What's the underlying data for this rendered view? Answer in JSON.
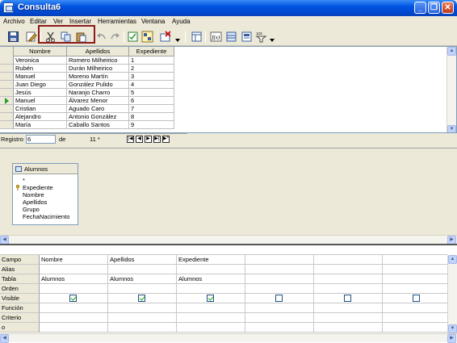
{
  "window": {
    "title": "Consulta6"
  },
  "menu": [
    "Archivo",
    "Editar",
    "Ver",
    "Insertar",
    "Herramientas",
    "Ventana",
    "Ayuda"
  ],
  "toolbar": {
    "icons": [
      "save-icon",
      "edit-icon",
      "cut-icon",
      "copy-icon",
      "paste-icon",
      "undo-icon",
      "redo-icon",
      "function-icon",
      "design-view-icon",
      "delete-table-icon",
      "table-icon",
      "functions-icon",
      "table-names-icon",
      "alias-icon",
      "distinct-icon"
    ]
  },
  "datagrid": {
    "columns": [
      "Nombre",
      "Apellidos",
      "Expediente"
    ],
    "rows": [
      [
        "Veronica",
        "Romero Milheirico",
        "1"
      ],
      [
        "Rubén",
        "Durán Milheirico",
        "2"
      ],
      [
        "Manuel",
        "Moreno Martín",
        "3"
      ],
      [
        "Juan Diego",
        "González Pulido",
        "4"
      ],
      [
        "Jesús",
        "Naranjo Charro",
        "5"
      ],
      [
        "Manuel",
        "Álvarez Menor",
        "6"
      ],
      [
        "Cristian",
        "Aguado Caro",
        "7"
      ],
      [
        "Alejandro",
        "Antonio González",
        "8"
      ],
      [
        "María",
        "Caballo Santos",
        "9"
      ]
    ],
    "current_row": 6
  },
  "navbar": {
    "label": "Registro",
    "record": "6",
    "of_label": "de",
    "total": "11 *"
  },
  "table_box": {
    "title": "Alumnos",
    "fields": [
      "*",
      "Expediente",
      "Nombre",
      "Apellidos",
      "Grupo",
      "FechaNacimiento"
    ],
    "key_field": "Expediente"
  },
  "criteria": {
    "row_labels": [
      "Campo",
      "Alias",
      "Tabla",
      "Orden",
      "Visible",
      "Función",
      "Criterio",
      "o"
    ],
    "columns": [
      {
        "campo": "Nombre",
        "tabla": "Alumnos",
        "visible": true
      },
      {
        "campo": "Apellidos",
        "tabla": "Alumnos",
        "visible": true
      },
      {
        "campo": "Expediente",
        "tabla": "Alumnos",
        "visible": true
      },
      {
        "campo": "",
        "tabla": "",
        "visible": false
      },
      {
        "campo": "",
        "tabla": "",
        "visible": false
      },
      {
        "campo": "",
        "tabla": "",
        "visible": false
      }
    ]
  }
}
